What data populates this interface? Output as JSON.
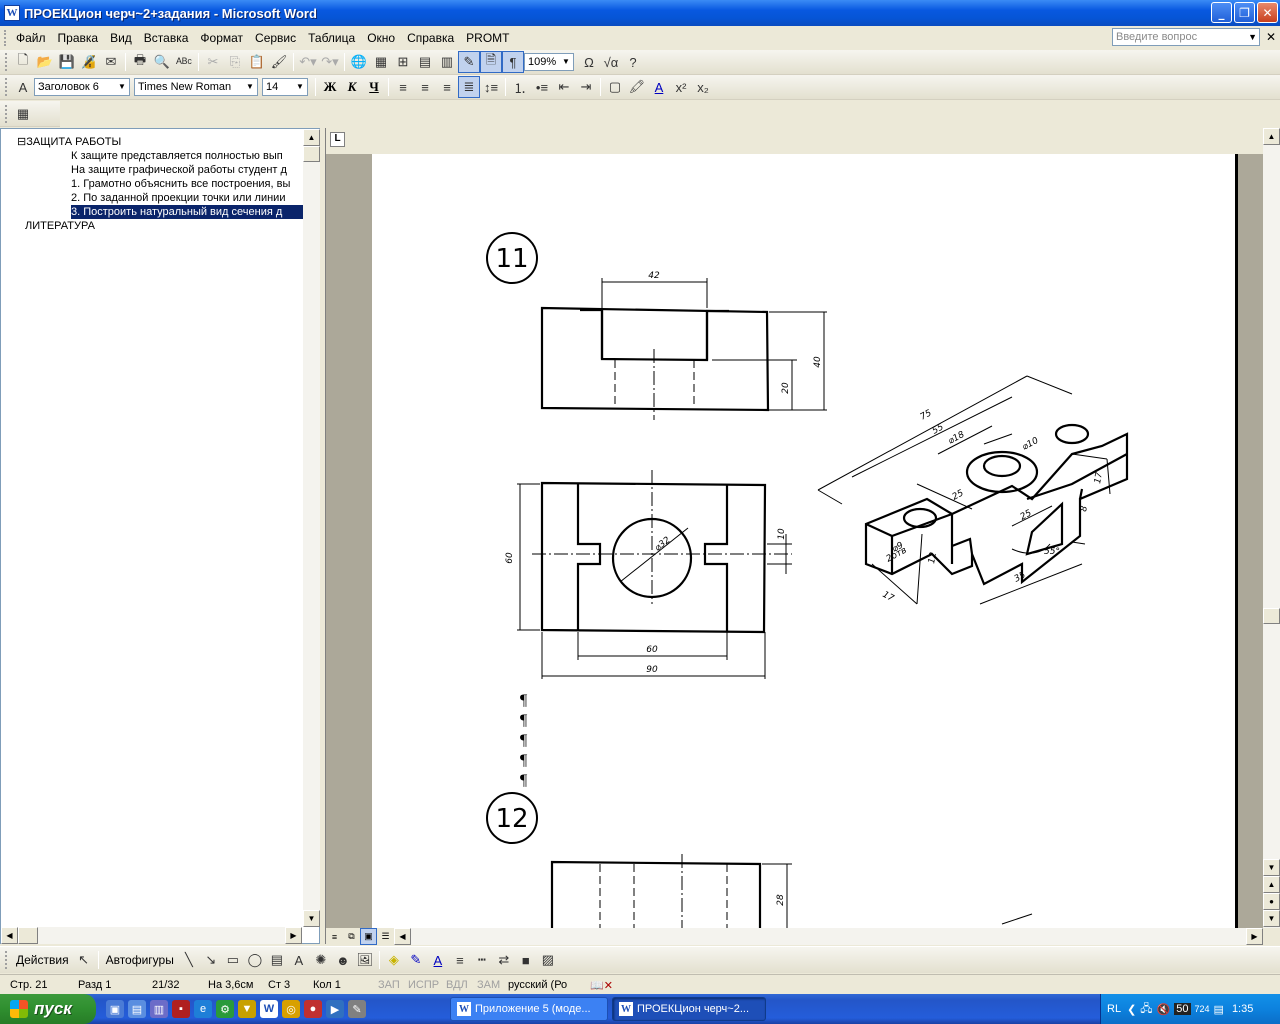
{
  "window": {
    "title": "ПРОЕКЦион черч~2+задания - Microsoft Word",
    "app_icon": "W"
  },
  "menu": {
    "items": [
      "Файл",
      "Правка",
      "Вид",
      "Вставка",
      "Формат",
      "Сервис",
      "Таблица",
      "Окно",
      "Справка",
      "PROMT"
    ],
    "ask_placeholder": "Введите вопрос"
  },
  "standard_toolbar": {
    "zoom": "109%"
  },
  "format_toolbar": {
    "style": "Заголовок 6",
    "font": "Times New Roman",
    "size": "14",
    "bold": "Ж",
    "italic": "К",
    "underline": "Ч"
  },
  "document_map": {
    "items": [
      {
        "label": "⊟ЗАЩИТА РАБОТЫ",
        "selected": false
      },
      {
        "label": "К защите представляется полностью вып",
        "selected": false
      },
      {
        "label": "На защите графической работы студент д",
        "selected": false
      },
      {
        "label": "1. Грамотно объяснить все построения, вы",
        "selected": false
      },
      {
        "label": "2. По заданной проекции точки или линии",
        "selected": false
      },
      {
        "label": "3. Построить натуральный вид сечения д",
        "selected": true
      },
      {
        "label": "ЛИТЕРАТУРА",
        "selected": false
      }
    ]
  },
  "drawing": {
    "figure1_number": "11",
    "figure2_number": "12",
    "dims": {
      "top_width": "42",
      "front_height": "40",
      "front_inner": "20",
      "plan_height": "60",
      "plan_slot": "10",
      "plan_circle": "⌀32",
      "plan_inner_width": "60",
      "plan_width": "90",
      "iso_length": "75",
      "iso_inner": "55",
      "iso_d18": "⌀18",
      "iso_d10": "⌀10",
      "iso_25a": "25",
      "iso_25b": "25",
      "iso_17a": "17",
      "iso_8": "8",
      "iso_12": "12",
      "iso_d9": "⌀9",
      "iso_2holes": "2отв",
      "iso_55deg": "55°",
      "iso_35": "35",
      "iso_17b": "17",
      "fig12_dim": "28"
    },
    "pilcrow": "¶"
  },
  "drawing_toolbar": {
    "actions": "Действия",
    "autoshapes": "Автофигуры"
  },
  "statusbar": {
    "page": "Стр. 21",
    "section": "Разд 1",
    "pages": "21/32",
    "at": "На 3,6см",
    "line": "Ст 3",
    "col": "Кол 1",
    "rec": "ЗАП",
    "trk": "ИСПР",
    "ext": "ВДЛ",
    "ovr": "ЗАМ",
    "lang": "русский (Ро"
  },
  "taskbar": {
    "start": "пуск",
    "tasks": [
      {
        "label": "Приложение 5 (моде...",
        "active": false
      },
      {
        "label": "ПРОЕКЦион черч~2...",
        "active": true
      }
    ],
    "tray_lang": "RL",
    "tray_n1": "50",
    "tray_n2": "724",
    "clock": "1:35"
  }
}
